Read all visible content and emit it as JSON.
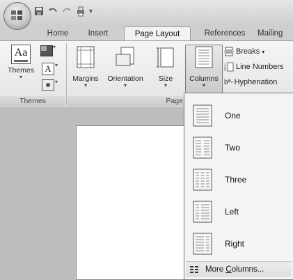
{
  "ribbon_tabs": [
    {
      "label": "Home"
    },
    {
      "label": "Insert"
    },
    {
      "label": "Page Layout"
    },
    {
      "label": "References"
    },
    {
      "label": "Mailing"
    }
  ],
  "themes_group": {
    "themes_label": "Themes",
    "footer": "Themes",
    "icon_text": "Aa",
    "fonts_icon_text": "A"
  },
  "page_setup_group": {
    "footer": "Page Se",
    "margins_label": "Margins",
    "orientation_label": "Orientation",
    "size_label": "Size",
    "columns_label": "Columns",
    "breaks_label": "Breaks",
    "line_numbers_label": "Line Numbers",
    "hyphenation_label": "Hyphenation",
    "hyphenation_icon_text": "bª-"
  },
  "columns_menu": {
    "items": [
      {
        "label": "One",
        "icon": "one-column-icon"
      },
      {
        "label": "Two",
        "icon": "two-columns-icon"
      },
      {
        "label": "Three",
        "icon": "three-columns-icon"
      },
      {
        "label": "Left",
        "icon": "left-column-icon"
      },
      {
        "label": "Right",
        "icon": "right-column-icon"
      }
    ],
    "more_label_pre": "More ",
    "more_label_accel": "C",
    "more_label_post": "olumns..."
  },
  "dropdown_arrow": "▾"
}
